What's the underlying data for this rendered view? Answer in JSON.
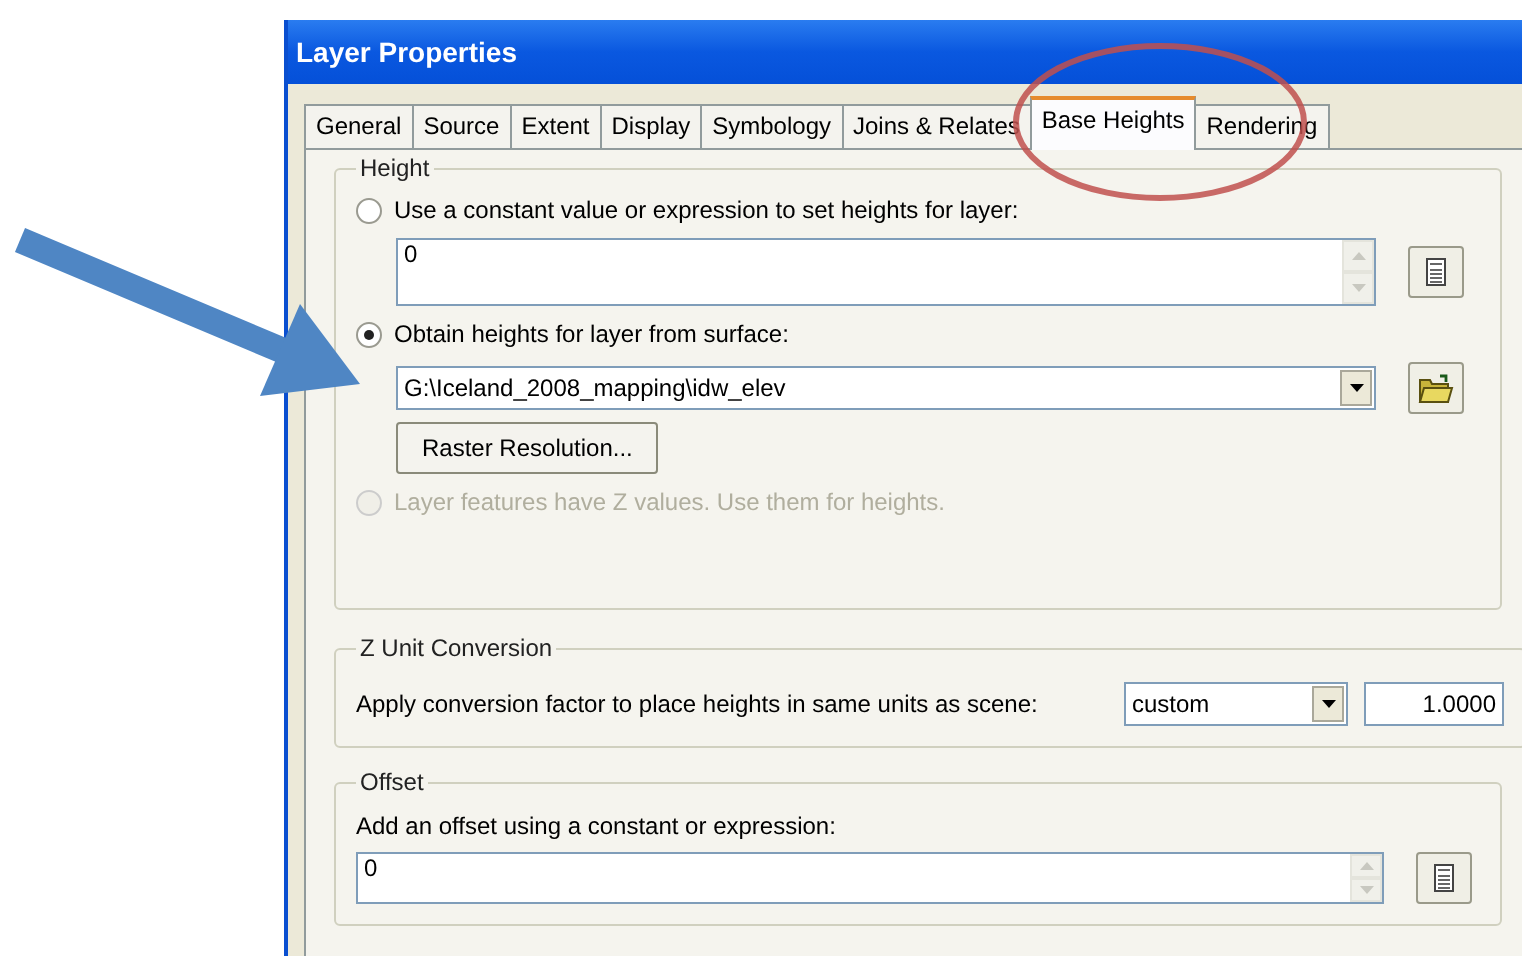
{
  "window": {
    "title": "Layer Properties"
  },
  "tabs": [
    {
      "label": "General",
      "selected": false
    },
    {
      "label": "Source",
      "selected": false
    },
    {
      "label": "Extent",
      "selected": false
    },
    {
      "label": "Display",
      "selected": false
    },
    {
      "label": "Symbology",
      "selected": false
    },
    {
      "label": "Joins & Relates",
      "selected": false
    },
    {
      "label": "Base Heights",
      "selected": true
    },
    {
      "label": "Rendering",
      "selected": false
    }
  ],
  "height_group": {
    "legend": "Height",
    "options": [
      {
        "label": "Use a constant value or expression to set heights for layer:",
        "selected": false,
        "disabled": false
      },
      {
        "label": "Obtain heights for layer from surface:",
        "selected": true,
        "disabled": false
      },
      {
        "label": "Layer features have Z values.  Use them for heights.",
        "selected": false,
        "disabled": true
      }
    ],
    "expression_field": {
      "value": "0"
    },
    "surface_dropdown": {
      "value": "G:\\Iceland_2008_mapping\\idw_elev"
    },
    "raster_button": "Raster Resolution..."
  },
  "z_unit_group": {
    "legend": "Z Unit Conversion",
    "label": "Apply conversion factor to place heights in same units as scene:",
    "unit_dropdown": {
      "value": "custom"
    },
    "factor_field": {
      "value": "1.0000"
    }
  },
  "offset_group": {
    "legend": "Offset",
    "label": "Add an offset using a constant or expression:",
    "expression_field": {
      "value": "0"
    }
  }
}
